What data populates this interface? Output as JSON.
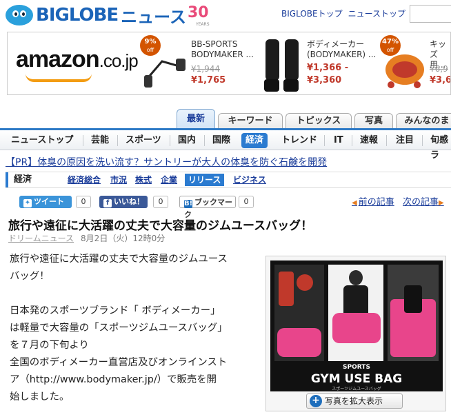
{
  "header": {
    "logo_text": "BIGLOBE",
    "logo_news": "ニュース",
    "logo_30": "30",
    "logo_years": "YEARS",
    "links": [
      "BIGLOBEトップ",
      "ニューストップ"
    ]
  },
  "ad": {
    "brand": "amazon",
    "brand_suffix": ".co.jp",
    "items": [
      {
        "badge_pct": "9%",
        "badge_off": "off",
        "title_1": "BB-SPORTS",
        "title_2": "BODYMAKER ...",
        "old_price": "¥1,944",
        "price": "¥1,765"
      },
      {
        "title_1": "ボディメーカー",
        "title_2": "(BODYMAKER) ...",
        "price": "¥1,366 -",
        "price_2": "¥3,360"
      },
      {
        "badge_pct": "47%",
        "badge_off": "off",
        "title_1": "キッズ",
        "title_2": "用...",
        "old_price": "¥6,9",
        "price": "¥3,6"
      }
    ]
  },
  "tabs": [
    "最新",
    "キーワード",
    "トピックス",
    "写真",
    "みんなのま"
  ],
  "categories": [
    "ニューストップ",
    "芸能",
    "スポーツ",
    "国内",
    "国際",
    "経済",
    "トレンド",
    "IT",
    "速報",
    "注目",
    "旬感ラ"
  ],
  "pr_link": "【PR】体臭の原因を洗い流す？サントリーが大人の体臭を防ぐ石鹸を開発",
  "subnav": {
    "section": "経済",
    "items": [
      "経済総合",
      "市況",
      "株式",
      "企業",
      "リリース",
      "ビジネス"
    ]
  },
  "social": {
    "tweet": "ツイート",
    "tweet_count": "0",
    "like": "いいね！",
    "like_count": "0",
    "hatena": "ブックマーク",
    "hatena_count": "0",
    "prev": "前の記事",
    "next": "次の記事"
  },
  "article": {
    "headline": "旅行や遠征に大活躍の丈夫で大容量のジムユースバッグ！",
    "source": "ドリームニュース",
    "date": "8月2日（火）12時0分",
    "p1_l1": "旅行や遠征に大活躍の丈夫で大容量のジムユース",
    "p1_l2": "バッグ！",
    "p2_l1": "日本発のスポーツブランド「 ボディメーカー」",
    "p2_l2": "は軽量で大容量の「スポーツジムユースバッグ」",
    "p2_l3": "を７月の下旬より",
    "p2_l4": "全国のボディメーカー直営店及びオンラインスト",
    "p2_l5": "ア（http://www.bodymaker.jp/）で販売を開",
    "p2_l6": "始しました。"
  },
  "figure": {
    "sports": "SPORTS",
    "title": "GYM USE BAG",
    "sub": "スポーツジムユースバッグ",
    "zoom_label": "写真を拡大表示"
  }
}
